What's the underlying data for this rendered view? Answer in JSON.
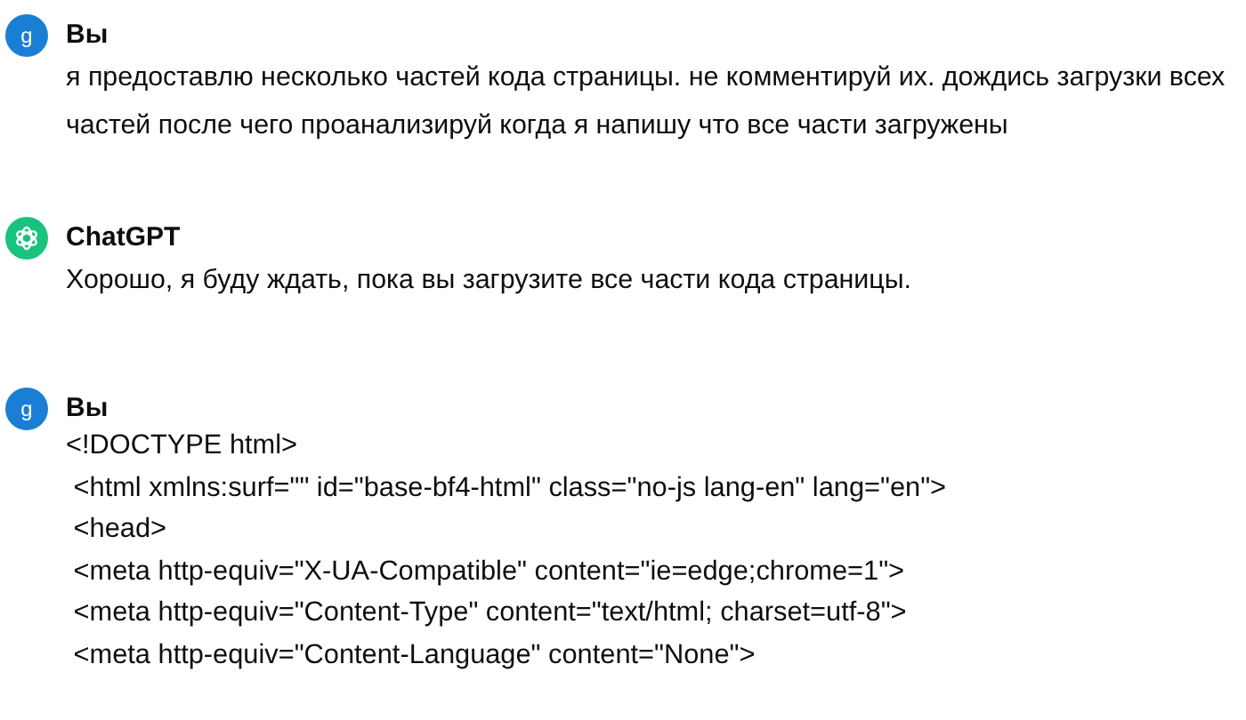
{
  "messages": [
    {
      "kind": "user",
      "avatar_letter": "g",
      "name": "Вы",
      "code": false,
      "lines": [
        "я предоставлю несколько частей кода страницы. не комментируй их. дождись загрузки всех",
        "частей после чего проанализируй когда я напишу что все части загружены"
      ]
    },
    {
      "kind": "assistant",
      "name": "ChatGPT",
      "code": false,
      "lines": [
        "Хорошо, я буду ждать, пока вы загрузите все части кода страницы."
      ]
    },
    {
      "kind": "user",
      "avatar_letter": "g",
      "name": "Вы",
      "code": true,
      "lines": [
        "<!DOCTYPE html>",
        " <html xmlns:surf=\"\" id=\"base-bf4-html\" class=\"no-js lang-en\" lang=\"en\">",
        " <head>",
        " <meta http-equiv=\"X-UA-Compatible\" content=\"ie=edge;chrome=1\">",
        " <meta http-equiv=\"Content-Type\" content=\"text/html; charset=utf-8\">",
        " <meta http-equiv=\"Content-Language\" content=\"None\">"
      ]
    }
  ]
}
